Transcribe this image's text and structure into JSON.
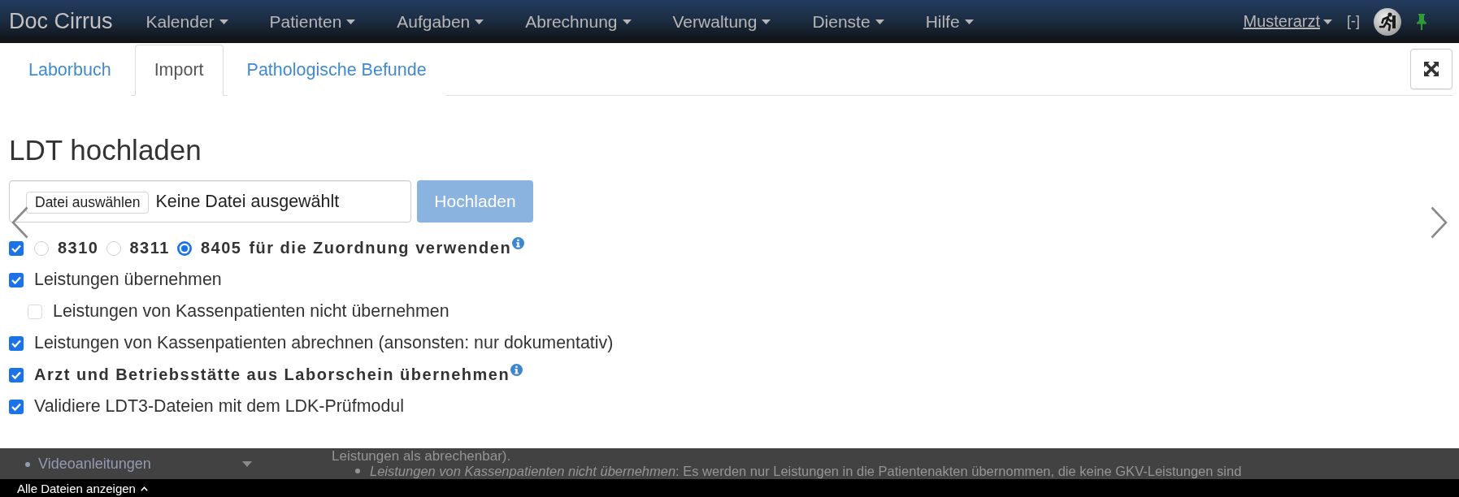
{
  "navbar": {
    "brand": "Doc Cirrus",
    "menus": [
      "Kalender",
      "Patienten",
      "Aufgaben",
      "Abrechnung",
      "Verwaltung",
      "Dienste",
      "Hilfe"
    ],
    "user": "Musterarzt",
    "collapse": "[-]"
  },
  "tabs": [
    {
      "label": "Laborbuch",
      "selected": false
    },
    {
      "label": "Import",
      "selected": true
    },
    {
      "label": "Pathologische Befunde",
      "selected": false
    }
  ],
  "upload": {
    "title": "LDT hochladen",
    "file_button": "Datei auswählen",
    "file_status": "Keine Datei ausgewählt",
    "submit": "Hochladen",
    "submit_disabled": true
  },
  "assignment": {
    "checked": true,
    "radios": [
      {
        "label": "8310",
        "selected": false
      },
      {
        "label": "8311",
        "selected": false
      },
      {
        "label": "8405",
        "selected": true
      }
    ],
    "suffix": "für die Zuordnung verwenden",
    "info": true
  },
  "options": [
    {
      "label": "Leistungen übernehmen",
      "checked": true,
      "bold": false,
      "info": false,
      "children": [
        {
          "label": "Leistungen von Kassenpatienten nicht übernehmen",
          "checked": false,
          "bold": false,
          "info": false
        }
      ]
    },
    {
      "label": "Leistungen von Kassenpatienten abrechnen (ansonsten: nur dokumentativ)",
      "checked": true,
      "bold": false,
      "info": false
    },
    {
      "label": "Arzt und Betriebsstätte aus Laborschein übernehmen",
      "checked": true,
      "bold": true,
      "info": true
    },
    {
      "label": "Validiere LDT3-Dateien mit dem LDK-Prüfmodul",
      "checked": true,
      "bold": false,
      "info": false
    }
  ],
  "background_page": {
    "sidebar_item": "Videoanleitungen",
    "text": "Leistungen als abrechenbar).",
    "bullet": "*Leistungen von Kassenpatienten nicht übernehmen*: Es werden nur Leistungen in die Patientenakten übernommen, die keine GKV-Leistungen sind"
  },
  "downloads_bar": {
    "link": "Alle Dateien anzeigen"
  }
}
